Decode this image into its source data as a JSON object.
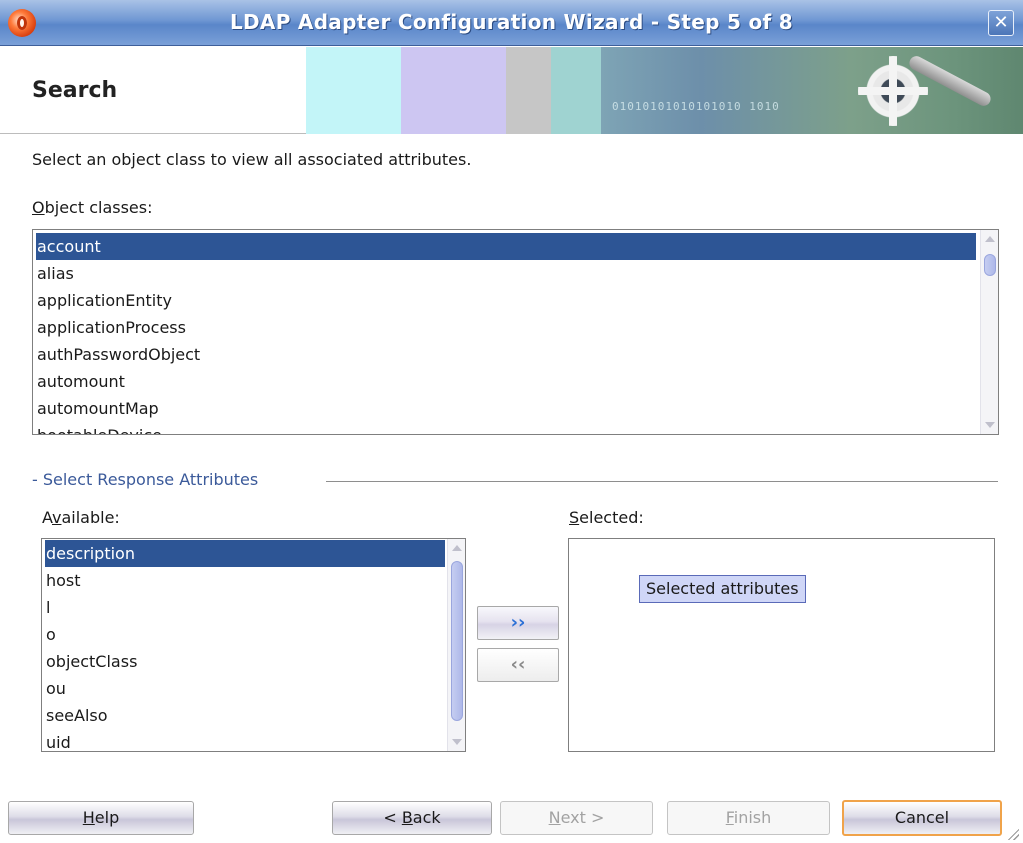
{
  "window": {
    "title": "LDAP Adapter Configuration Wizard - Step 5 of 8",
    "close_glyph": "✕"
  },
  "header": {
    "page_title": "Search",
    "banner_binary": "01010101010101010 1010"
  },
  "instructions": "Select an object class to view all associated attributes.",
  "object_classes": {
    "label_mnemonic": "O",
    "label_rest": "bject classes:",
    "items": [
      "account",
      "alias",
      "applicationEntity",
      "applicationProcess",
      "authPasswordObject",
      "automount",
      "automountMap",
      "bootableDevice"
    ],
    "selected_index": 0
  },
  "response_attributes": {
    "section_label": "- Select Response Attributes",
    "available_label_pre": "A",
    "available_label_mnemonic": "v",
    "available_label_post": "ailable:",
    "selected_label_mnemonic": "S",
    "selected_label_rest": "elected:",
    "available_items": [
      "description",
      "host",
      "l",
      "o",
      "objectClass",
      "ou",
      "seeAlso",
      "uid"
    ],
    "available_selected_index": 0,
    "selected_placeholder": "Selected attributes",
    "move_right_icon": "chevron-right-icon",
    "move_left_icon": "chevron-left-icon"
  },
  "buttons": {
    "help_mnemonic": "H",
    "help_rest": "elp",
    "back_pre": "< ",
    "back_mnemonic": "B",
    "back_rest": "ack",
    "next_mnemonic": "N",
    "next_rest": "ext >",
    "finish_mnemonic": "F",
    "finish_rest": "inish",
    "cancel": "Cancel"
  },
  "colors": {
    "selection": "#2d5595",
    "accent_text": "#3b5a9a",
    "default_button_border": "#f0a34a"
  }
}
